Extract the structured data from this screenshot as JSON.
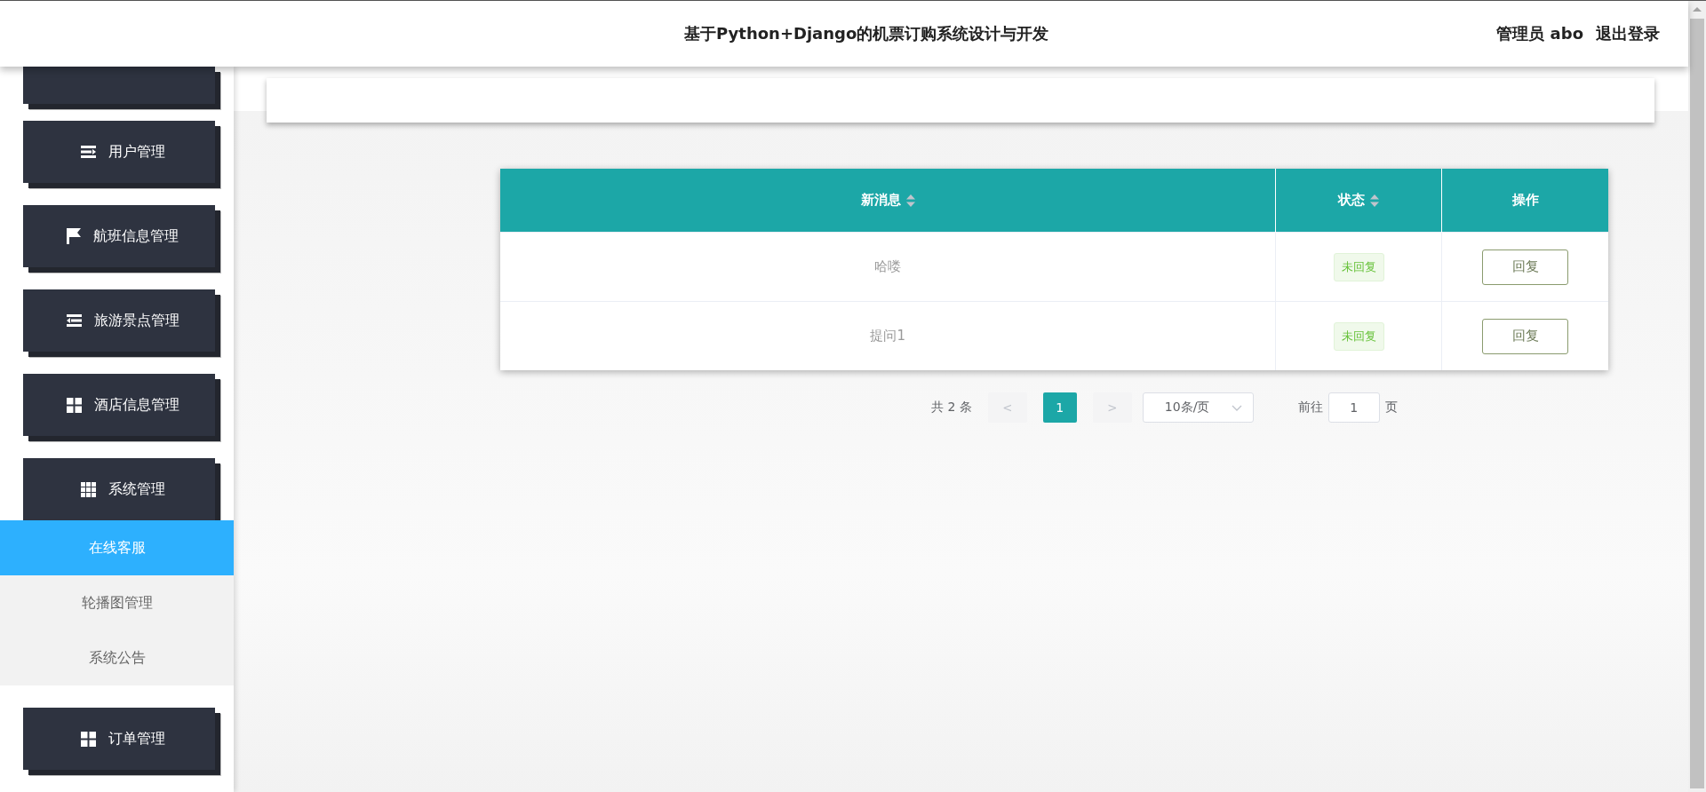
{
  "header": {
    "title": "基于Python+Django的机票订购系统设计与开发",
    "user": "管理员 abo",
    "logout": "退出登录"
  },
  "sidebar": {
    "items": [
      {
        "label": "用户管理",
        "expanded": false
      },
      {
        "label": "航班信息管理",
        "expanded": false
      },
      {
        "label": "旅游景点管理",
        "expanded": false
      },
      {
        "label": "酒店信息管理",
        "expanded": false
      },
      {
        "label": "系统管理",
        "expanded": true,
        "children": [
          {
            "label": "在线客服",
            "selected": true
          },
          {
            "label": "轮播图管理",
            "selected": false
          },
          {
            "label": "系统公告",
            "selected": false
          }
        ]
      },
      {
        "label": "订单管理",
        "expanded": false
      }
    ]
  },
  "table": {
    "columns": [
      {
        "label": "新消息",
        "sortable": true
      },
      {
        "label": "状态",
        "sortable": true
      },
      {
        "label": "操作",
        "sortable": false
      }
    ],
    "rows": [
      {
        "message": "哈喽",
        "status": "未回复",
        "action": "回复"
      },
      {
        "message": "提问1",
        "status": "未回复",
        "action": "回复"
      }
    ]
  },
  "pagination": {
    "total": "共 2 条",
    "prev": "<",
    "pages": [
      {
        "label": "1",
        "selected": true
      }
    ],
    "next": ">",
    "page_size": "10条/页",
    "goto_label": "前往",
    "goto_value": "1",
    "goto_suffix": "页"
  }
}
